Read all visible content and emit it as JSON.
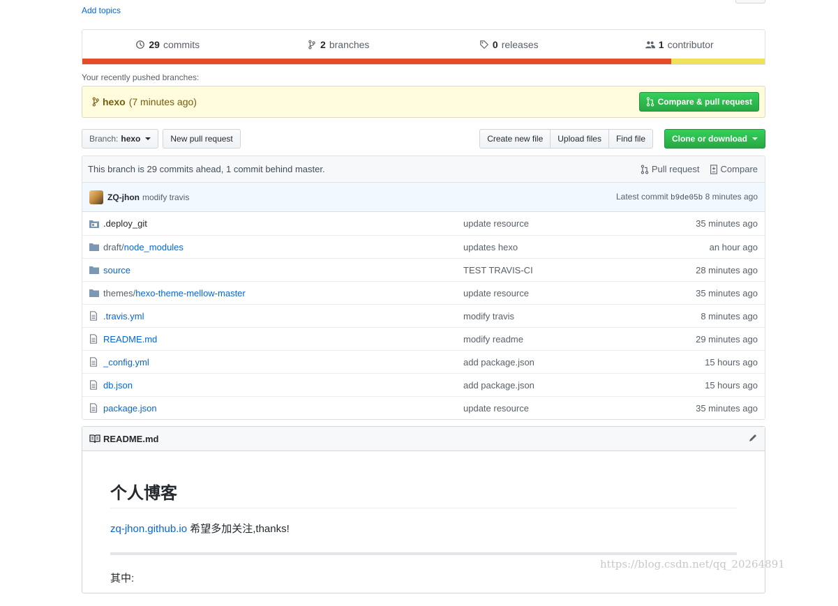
{
  "topics": {
    "add_label": "Add topics"
  },
  "summary": {
    "commits_count": "29",
    "commits_label": "commits",
    "branches_count": "2",
    "branches_label": "branches",
    "releases_count": "0",
    "releases_label": "releases",
    "contributors_count": "1",
    "contributors_label": "contributor",
    "languages": [
      {
        "color": "#e34c26",
        "fraction": 0.863
      },
      {
        "color": "#f1e05a",
        "fraction": 0.137
      }
    ]
  },
  "recent": {
    "label": "Your recently pushed branches:",
    "branch": "hexo",
    "time": "(7 minutes ago)",
    "compare_button": "Compare & pull request"
  },
  "toolbar": {
    "branch_prefix": "Branch:",
    "branch_name": "hexo",
    "new_pr": "New pull request",
    "create_file": "Create new file",
    "upload_files": "Upload files",
    "find_file": "Find file",
    "clone": "Clone or download"
  },
  "branch_status": {
    "text": "This branch is 29 commits ahead, 1 commit behind master.",
    "pull_request": "Pull request",
    "compare": "Compare"
  },
  "latest_commit": {
    "author": "ZQ-jhon",
    "message": "modify travis",
    "label": "Latest commit",
    "sha": "b9de05b",
    "time": "8 minutes ago"
  },
  "files": [
    {
      "type": "submodule",
      "prefix": "",
      "name": ".deploy_git",
      "message": "update resource",
      "age": "35 minutes ago"
    },
    {
      "type": "dir",
      "prefix": "draft/",
      "name": "node_modules",
      "message": "updates hexo",
      "age": "an hour ago"
    },
    {
      "type": "dir",
      "prefix": "",
      "name": "source",
      "message": "TEST TRAVIS-CI",
      "age": "28 minutes ago"
    },
    {
      "type": "dir",
      "prefix": "themes/",
      "name": "hexo-theme-mellow-master",
      "message": "update resource",
      "age": "35 minutes ago"
    },
    {
      "type": "file",
      "prefix": "",
      "name": ".travis.yml",
      "message": "modify travis",
      "age": "8 minutes ago"
    },
    {
      "type": "file",
      "prefix": "",
      "name": "README.md",
      "message": "modify readme",
      "age": "29 minutes ago"
    },
    {
      "type": "file",
      "prefix": "",
      "name": "_config.yml",
      "message": "add package.json",
      "age": "15 hours ago"
    },
    {
      "type": "file",
      "prefix": "",
      "name": "db.json",
      "message": "add package.json",
      "age": "15 hours ago"
    },
    {
      "type": "file",
      "prefix": "",
      "name": "package.json",
      "message": "update resource",
      "age": "35 minutes ago"
    }
  ],
  "readme": {
    "title": "README.md",
    "heading": "个人博客",
    "link": "zq-jhon.github.io",
    "tagline": " 希望多加关注,thanks!",
    "cut_text": "其中:"
  },
  "watermark": "https://blog.csdn.net/qq_20264891",
  "colors": {
    "link": "#0366d6",
    "green": "#28a745",
    "yellow_bg": "#fffbdd"
  }
}
